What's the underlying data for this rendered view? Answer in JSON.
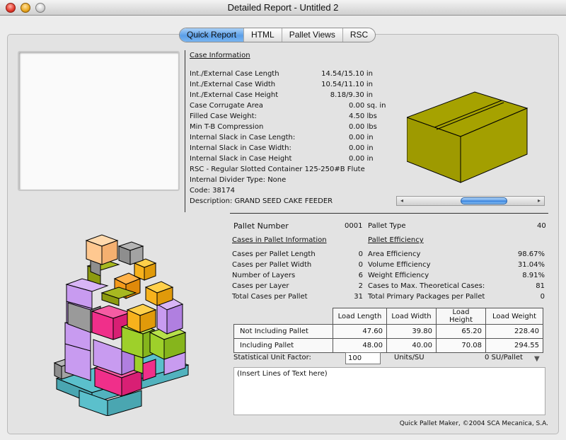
{
  "window": {
    "title": "Detailed Report - Untitled 2"
  },
  "tabs": [
    {
      "label": "Quick Report",
      "active": true
    },
    {
      "label": "HTML",
      "active": false
    },
    {
      "label": "Pallet Views",
      "active": false
    },
    {
      "label": "RSC",
      "active": false
    }
  ],
  "case_info": {
    "heading": "Case Information",
    "rows": [
      {
        "label": "Int./External Case Length",
        "value": "14.54/15.10 in"
      },
      {
        "label": "Int./External Case Width",
        "value": "10.54/11.10 in"
      },
      {
        "label": "Int./External Case Height",
        "value": "8.18/9.30 in"
      },
      {
        "label": "Case Corrugate Area",
        "value": "0.00 sq. in"
      },
      {
        "label": "Filled Case Weight:",
        "value": "4.50 lbs"
      },
      {
        "label": "Min T-B Compression",
        "value": "0.00 lbs"
      },
      {
        "label": "Internal Slack in Case Length:",
        "value": "0.00 in"
      },
      {
        "label": "Internal Slack in Case Width:",
        "value": "0.00 in"
      },
      {
        "label": "Internal Slack in Case Height",
        "value": "0.00 in"
      }
    ],
    "lines": [
      "RSC - Regular Slotted Container 125-250#B Flute",
      "Internal Divider Type: None",
      "Code: 38174",
      "Description: GRAND SEED CAKE FEEDER"
    ]
  },
  "pallet": {
    "number_label": "Pallet Number",
    "number_value": "0001",
    "type_label": "Pallet Type",
    "type_value": "40",
    "info_heading": "Cases in Pallet Information",
    "efficiency_heading": "Pallet Efficiency",
    "info_rows": [
      {
        "label": "Cases per Pallet Length",
        "value": "0"
      },
      {
        "label": "Cases per Pallet Width",
        "value": "0"
      },
      {
        "label": "Number of Layers",
        "value": "6"
      },
      {
        "label": "Cases per Layer",
        "value": "2"
      },
      {
        "label": "Total Cases per Pallet",
        "value": "31"
      }
    ],
    "efficiency_rows": [
      {
        "label": "Area Efficiency",
        "value": "98.67%"
      },
      {
        "label": "Volume Efficiency",
        "value": "31.04%"
      },
      {
        "label": "Weight Efficiency",
        "value": "8.91%"
      },
      {
        "label": "Cases to Max. Theoretical Cases:",
        "value": "81"
      },
      {
        "label": "Total Primary Packages per Pallet",
        "value": "0"
      }
    ]
  },
  "load_table": {
    "headers": [
      "Load Length",
      "Load Width",
      "Load Height",
      "Load Weight"
    ],
    "rows": [
      {
        "label": "Not Including Pallet",
        "values": [
          "47.60",
          "39.80",
          "65.20",
          "228.40"
        ]
      },
      {
        "label": "Including Pallet",
        "values": [
          "48.00",
          "40.00",
          "70.08",
          "294.55"
        ]
      }
    ]
  },
  "suf": {
    "label": "Statistical Unit Factor:",
    "value": "100",
    "units": "Units/SU",
    "su_per_pallet": "0 SU/Pallet"
  },
  "notes": {
    "text": "(Insert Lines of Text here)"
  },
  "footer": {
    "text": "Quick Pallet Maker, ©2004 SCA Mecanica, S.A."
  },
  "colors": {
    "case_box": "#9e9a00",
    "tab_active": "#5a9ee8",
    "pallet_blue": "#5bc0cc",
    "case_purple": "#c89bf0",
    "case_pink": "#f02f8a",
    "case_green": "#9ed02a",
    "case_orange": "#f7b21c",
    "case_gray": "#9a9a9a",
    "case_peach": "#ffc890"
  },
  "icons": {
    "scroll_left": "◂",
    "scroll_right": "▸",
    "popup": "▼"
  }
}
